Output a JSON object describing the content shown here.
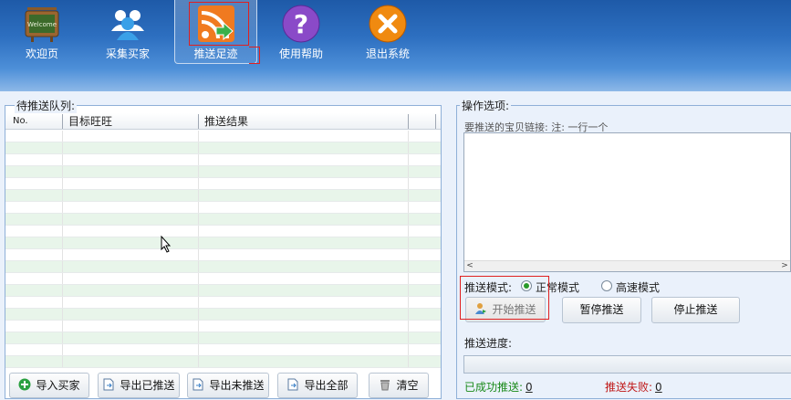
{
  "toolbar": {
    "items": [
      {
        "label": "欢迎页",
        "icon": "welcome-board-icon"
      },
      {
        "label": "采集买家",
        "icon": "users-icon"
      },
      {
        "label": "推送足迹",
        "icon": "rss-push-icon"
      },
      {
        "label": "使用帮助",
        "icon": "help-icon"
      },
      {
        "label": "退出系统",
        "icon": "exit-icon"
      }
    ],
    "active_index": 2,
    "welcome_sign_text": "Welcome"
  },
  "queue": {
    "title": "待推送队列:",
    "columns": [
      "No.",
      "目标旺旺",
      "推送结果"
    ],
    "rows": []
  },
  "bottom_buttons": {
    "import": "导入买家",
    "export_pushed": "导出已推送",
    "export_unpushed": "导出未推送",
    "export_all": "导出全部",
    "clear": "清空"
  },
  "options": {
    "title": "操作选项:",
    "link_hint": "要推送的宝贝链接: 注: 一行一个",
    "links_value": "",
    "mode_label": "推送模式:",
    "mode_normal": "正常模式",
    "mode_fast": "高速模式",
    "mode_selected": "正常模式",
    "start": "开始推送",
    "pause": "暂停推送",
    "stop": "停止推送",
    "progress_label": "推送进度:",
    "progress": 0,
    "success_label": "已成功推送:",
    "success_count": "0",
    "fail_label": "推送失败:",
    "fail_count": "0"
  },
  "colors": {
    "toolbar_top": "#1e5aa8",
    "toolbar_bottom": "#8db8e8",
    "success": "#1a8a1a",
    "failure": "#c01818",
    "highlight_box": "#e02020",
    "row_alt": "#e8f5ea"
  }
}
